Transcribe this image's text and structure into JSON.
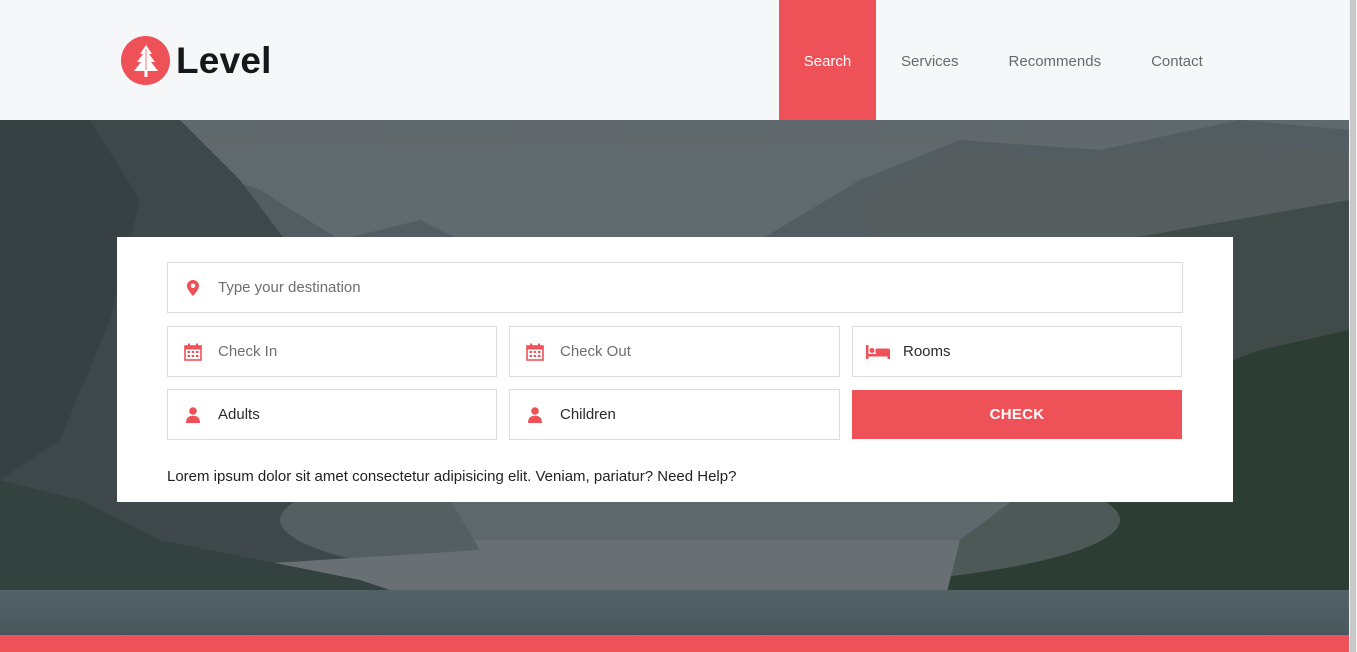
{
  "brand": {
    "name": "Level",
    "accent": "#ef5158",
    "logo_icon": "pine-tree-icon"
  },
  "nav": {
    "items": [
      {
        "label": "Search",
        "active": true
      },
      {
        "label": "Services",
        "active": false
      },
      {
        "label": "Recommends",
        "active": false
      },
      {
        "label": "Contact",
        "active": false
      }
    ]
  },
  "search": {
    "destination": {
      "placeholder": "Type your destination",
      "icon": "map-pin-icon"
    },
    "check_in": {
      "placeholder": "Check In",
      "icon": "calendar-icon"
    },
    "check_out": {
      "placeholder": "Check Out",
      "icon": "calendar-icon"
    },
    "rooms": {
      "value": "Rooms",
      "icon": "bed-icon"
    },
    "adults": {
      "value": "Adults",
      "icon": "user-icon"
    },
    "children": {
      "value": "Children",
      "icon": "user-icon"
    },
    "submit_label": "CHECK",
    "note": "Lorem ipsum dolor sit amet consectetur adipisicing elit. Veniam, pariatur? Need Help?"
  },
  "hero": {
    "background": "mountain-lake-photo"
  }
}
